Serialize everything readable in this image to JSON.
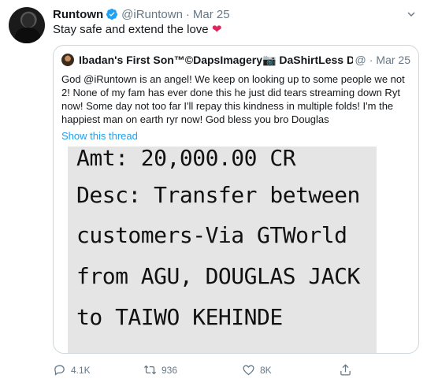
{
  "tweet": {
    "name": "Runtown",
    "handle": "@iRuntown",
    "separator": "·",
    "time": "Mar 25",
    "text": "Stay safe and extend the love",
    "emoji": "❤",
    "verified": true,
    "icons": {
      "avatar": "user-avatar",
      "verified": "verified-badge-icon",
      "caret": "chevron-down-icon"
    }
  },
  "quote": {
    "name": "Ibadan's First Son™©DapsImagery📷 DaShirtLess Dude 🤤",
    "handle": "@",
    "separator": "·",
    "time": "Mar 25",
    "text": "God @iRuntown is an angel! We keep on looking up to some people we not 2! None of my fam has ever done this he just did tears streaming down Ryt now! Some day not too far I'll repay this kindness in multiple folds! I'm the happiest man on earth ryr now! God bless you bro Douglas",
    "show_thread": "Show this thread",
    "image_lines": [
      "Amt: 20,000.00 CR",
      "Desc: Transfer between",
      "customers-Via GTWorld",
      "from AGU, DOUGLAS JACK",
      "to TAIWO KEHINDE"
    ]
  },
  "actions": {
    "reply": "4.1K",
    "retweet": "936",
    "like": "8K",
    "icons": [
      "reply-icon",
      "retweet-icon",
      "like-icon",
      "share-icon"
    ]
  },
  "colors": {
    "link": "#1da1f2",
    "secondary": "#657786",
    "heart": "#e0245e",
    "border": "#ccd6dd"
  }
}
